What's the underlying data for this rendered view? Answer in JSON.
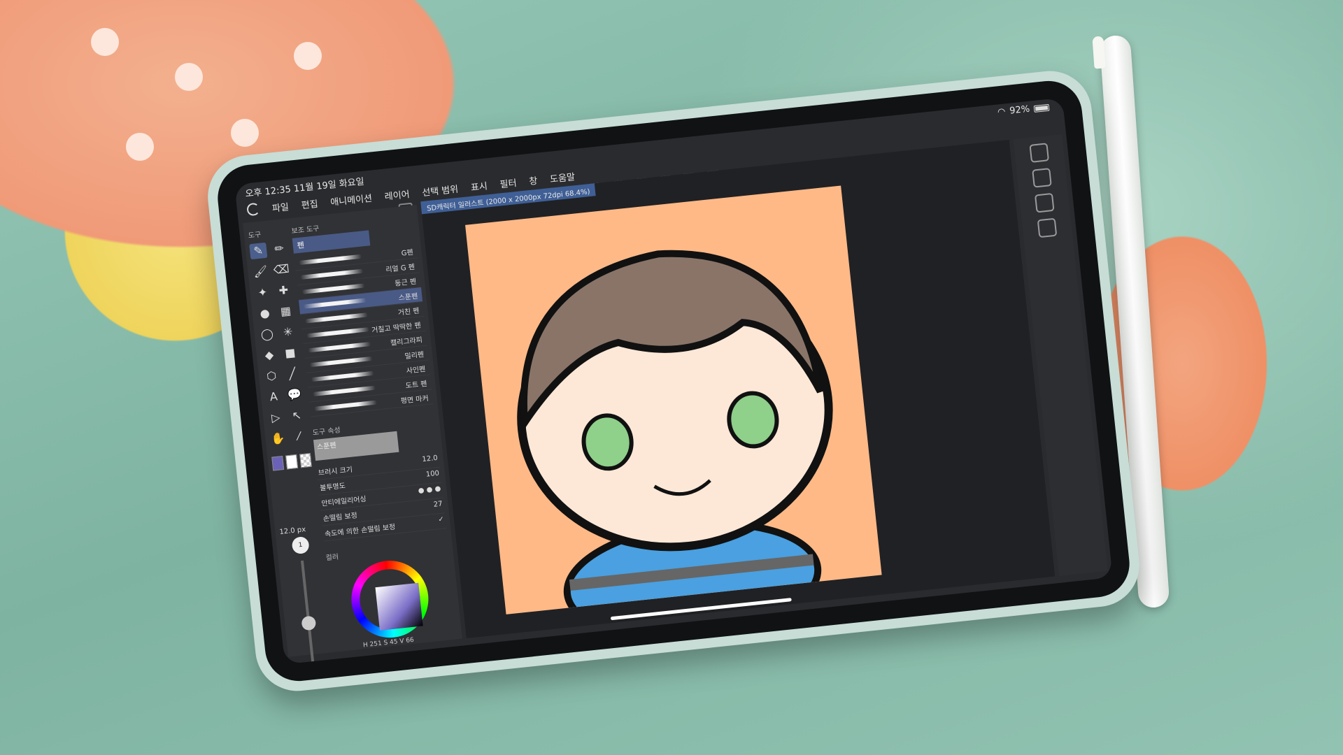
{
  "status": {
    "time": "오후 12:35  11월 19일 화요일",
    "battery": "92%"
  },
  "menu": [
    "파일",
    "편집",
    "애니메이션",
    "레이어",
    "선택 범위",
    "표시",
    "필터",
    "창",
    "도움말"
  ],
  "document": {
    "tab": "SD캐릭터 일러스트 (2000 x 2000px 72dpi 68.4%)"
  },
  "tool_palette": {
    "header": "도구",
    "sub_header": "보조 도구",
    "category": "펜",
    "brushes": [
      {
        "name": "G펜"
      },
      {
        "name": "리얼 G 펜"
      },
      {
        "name": "둥근 펜"
      },
      {
        "name": "스푼펜"
      },
      {
        "name": "거친 펜"
      },
      {
        "name": "거칠고 딱딱한 펜"
      },
      {
        "name": "캘리그라피"
      },
      {
        "name": "밀리펜"
      },
      {
        "name": "사인펜"
      },
      {
        "name": "도트 펜"
      },
      {
        "name": "평면 마커"
      }
    ],
    "selected_index": 3
  },
  "tool_property": {
    "header": "도구 속성",
    "preview_label": "스푼펜",
    "brush_size_label": "브러시 크기",
    "brush_size_value": "12.0",
    "opacity_label": "불투명도",
    "opacity_value": "100",
    "antialias_label": "안티에일리어싱",
    "stabilization_label": "손떨림 보정",
    "stabilization_value": "27",
    "speed_stabilization_label": "속도에 의한 손떨림 보정"
  },
  "brush_size_panel": {
    "value": "12.0",
    "unit": "px",
    "circle_label": "1"
  },
  "color": {
    "header": "컬러",
    "h": "251",
    "s": "45",
    "v": "66",
    "main": "#6b62b8"
  },
  "colors": {
    "canvas_bg": "#ffb987",
    "selection": "#4a5a86",
    "panel_bg": "#313236"
  }
}
